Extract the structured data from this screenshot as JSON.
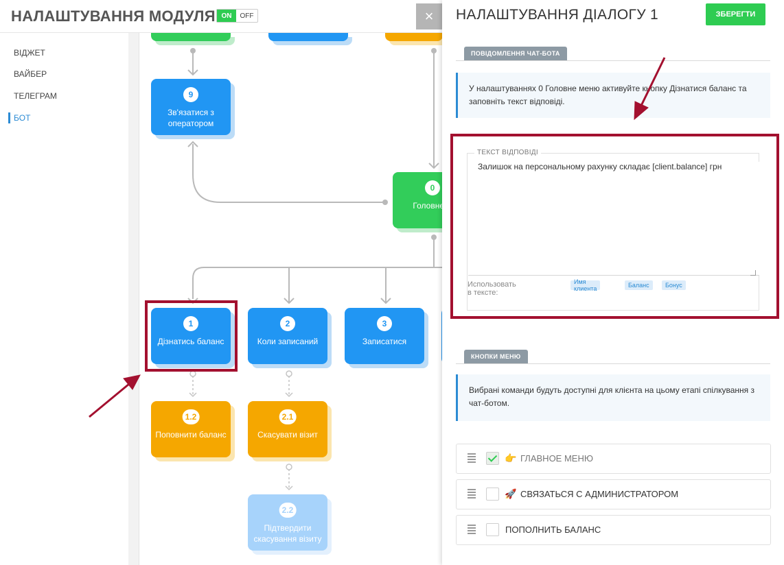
{
  "header": {
    "module_title": "НАЛАШТУВАННЯ МОДУЛЯ",
    "toggle_on": "ON",
    "toggle_off": "OFF",
    "close_glyph": "×"
  },
  "sidebar": {
    "items": [
      {
        "label": "ВІДЖЕТ"
      },
      {
        "label": "ВАЙБЕР"
      },
      {
        "label": "ТЕЛЕГРАМ"
      },
      {
        "label": "БОТ"
      }
    ]
  },
  "flow": {
    "nodes": [
      {
        "num": "9",
        "label": "Зв'язатися з оператором"
      },
      {
        "num": "0",
        "label": "Головне м"
      },
      {
        "num": "1",
        "label": "Дізнатись баланс"
      },
      {
        "num": "2",
        "label": "Коли записаний"
      },
      {
        "num": "3",
        "label": "Записатися"
      },
      {
        "num": "1.2",
        "label": "Поповнити баланс"
      },
      {
        "num": "2.1",
        "label": "Скасувати візит"
      },
      {
        "num": "2.2",
        "label": "Підтвердити скасування візиту"
      }
    ]
  },
  "panel": {
    "title": "НАЛАШТУВАННЯ ДІАЛОГУ 1",
    "save_label": "ЗБЕРЕГТИ",
    "chatbot_section": "ПОВІДОМЛЕННЯ ЧАТ-БОТА",
    "chatbot_info": "У налаштуваннях 0 Головне меню активуйте кнопку Дізнатися баланс та заповніть текст відповіді.",
    "reply_legend": "ТЕКСТ ВІДПОВІДІ",
    "reply_text": "Залишок на персональному рахунку складає [client.balance] грн",
    "use_in_text": "Использовать в тексте:",
    "tags": [
      "Имя клиента",
      "Баланс",
      "Бонус"
    ],
    "menu_section": "КНОПКИ МЕНЮ",
    "menu_info": "Вибрані команди будуть доступні для клієнта на цьому етапі спілкування з чат-ботом.",
    "menu_items": [
      {
        "emoji": "👉",
        "label": "ГЛАВНОЕ МЕНЮ",
        "checked": true
      },
      {
        "emoji": "🚀",
        "label": "СВЯЗАТЬСЯ С АДМИНИСТРАТОРОМ",
        "checked": false
      },
      {
        "emoji": "",
        "label": "ПОПОЛНИТЬ БАЛАНС",
        "checked": false
      }
    ]
  },
  "colors": {
    "blue": "#2196f3",
    "green": "#32cd5a",
    "orange": "#f5a700",
    "highlight": "#a3102f"
  }
}
